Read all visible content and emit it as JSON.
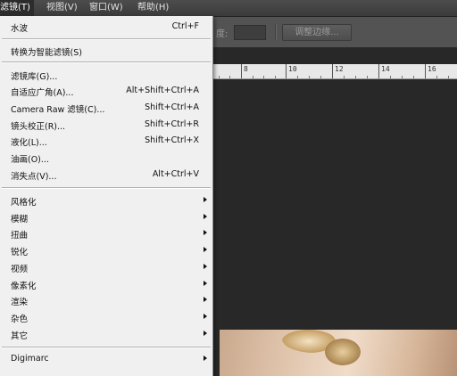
{
  "menubar": {
    "filter": "滤镜(T)",
    "view": "视图(V)",
    "window": "窗口(W)",
    "help": "帮助(H)"
  },
  "options": {
    "field_label": "度:",
    "refine_edge": "调整边缘..."
  },
  "ruler": {
    "labels": [
      "8",
      "10",
      "12",
      "14",
      "16"
    ]
  },
  "menu": {
    "last_filter": {
      "label": "水波",
      "shortcut": "Ctrl+F"
    },
    "convert_smart": "转换为智能滤镜(S)",
    "group1": [
      {
        "label": "滤镜库(G)...",
        "shortcut": ""
      },
      {
        "label": "自适应广角(A)...",
        "shortcut": "Alt+Shift+Ctrl+A"
      },
      {
        "label": "Camera Raw 滤镜(C)...",
        "shortcut": "Shift+Ctrl+A"
      },
      {
        "label": "镜头校正(R)...",
        "shortcut": "Shift+Ctrl+R"
      },
      {
        "label": "液化(L)...",
        "shortcut": "Shift+Ctrl+X"
      },
      {
        "label": "油画(O)...",
        "shortcut": ""
      },
      {
        "label": "消失点(V)...",
        "shortcut": "Alt+Ctrl+V"
      }
    ],
    "group2": [
      "风格化",
      "模糊",
      "扭曲",
      "锐化",
      "视频",
      "像素化",
      "渲染",
      "杂色",
      "其它"
    ],
    "group3": [
      "Digimarc"
    ]
  },
  "colors": {
    "menubar": "#3d3d3d",
    "menu_bg": "#f0f0f0",
    "workspace": "#282828"
  }
}
